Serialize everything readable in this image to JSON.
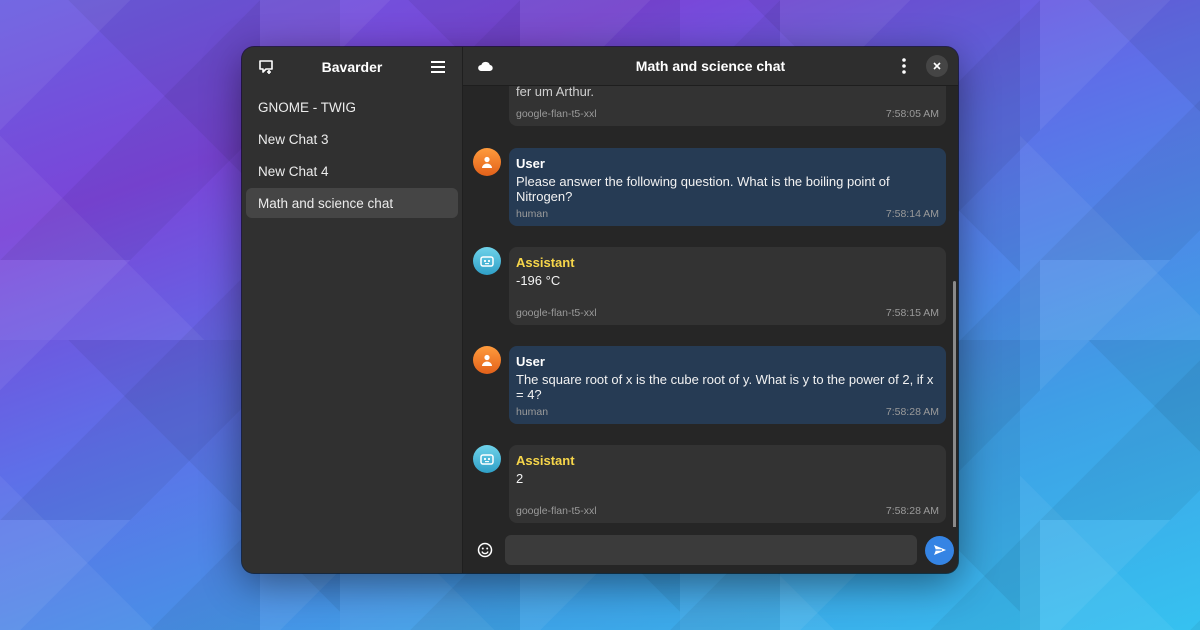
{
  "sidebar": {
    "title": "Bavarder",
    "new_chat_icon": "new-chat-icon",
    "menu_icon": "hamburger-menu-icon",
    "items": [
      {
        "label": "GNOME - TWIG"
      },
      {
        "label": "New Chat 3"
      },
      {
        "label": "New Chat 4"
      },
      {
        "label": "Math and science chat",
        "active": true
      }
    ]
  },
  "header": {
    "title": "Math and science chat",
    "provider_icon": "cloud-icon",
    "more_icon": "kebab-menu-icon",
    "close_icon": "close-icon"
  },
  "messages": [
    {
      "role": "assistant",
      "author": "",
      "text": "fer um Arthur.",
      "source": "google-flan-t5-xxl",
      "time": "7:58:05 AM"
    },
    {
      "role": "user",
      "author": "User",
      "text": "Please answer the following question. What is the boiling point of Nitrogen?",
      "source": "human",
      "time": "7:58:14 AM"
    },
    {
      "role": "assistant",
      "author": "Assistant",
      "text": "-196 °C",
      "source": "google-flan-t5-xxl",
      "time": "7:58:15 AM"
    },
    {
      "role": "user",
      "author": "User",
      "text": "The square root of x is the cube root of y. What is y to the power of 2, if x = 4?",
      "source": "human",
      "time": "7:58:28 AM"
    },
    {
      "role": "assistant",
      "author": "Assistant",
      "text": "2",
      "source": "google-flan-t5-xxl",
      "time": "7:58:28 AM"
    }
  ],
  "composer": {
    "emoji_icon": "emoji-icon",
    "placeholder": "",
    "send_icon": "send-icon"
  },
  "colors": {
    "accent": "#3584e4",
    "user_bubble": "#263b54",
    "assistant_name": "#f7d64a"
  }
}
